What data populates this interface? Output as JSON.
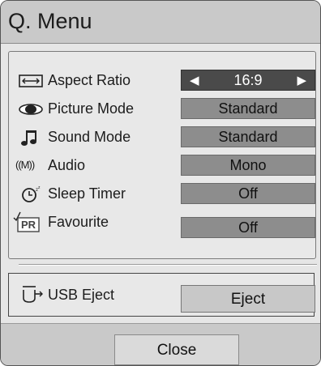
{
  "menu": {
    "title": "Q. Menu"
  },
  "settings": [
    {
      "label": "Aspect Ratio",
      "value": "16:9",
      "icon": "aspect-ratio-icon",
      "selected": true
    },
    {
      "label": "Picture Mode",
      "value": "Standard",
      "icon": "eye-icon",
      "selected": false
    },
    {
      "label": "Sound Mode",
      "value": "Standard",
      "icon": "music-note-icon",
      "selected": false
    },
    {
      "label": "Audio",
      "value": "Mono",
      "icon": "audio-mono-icon",
      "selected": false
    },
    {
      "label": "Sleep Timer",
      "value": "Off",
      "icon": "sleep-timer-icon",
      "selected": false
    },
    {
      "label": "Favourite",
      "value": "Off",
      "icon": "favourite-pr-icon",
      "selected": false
    }
  ],
  "arrows": {
    "left": "◀",
    "right": "▶"
  },
  "audio_icon_text": "((M))",
  "favourite_icon_text": "PR",
  "usb": {
    "label": "USB Eject",
    "button": "Eject",
    "icon": "usb-eject-icon"
  },
  "footer": {
    "close_label": "Close"
  },
  "colors": {
    "selected_value_bg": "#4a4a4a",
    "value_bg": "#8d8d8d",
    "panel_bg": "#e6e6e6",
    "header_bg": "#c9c9c9"
  }
}
